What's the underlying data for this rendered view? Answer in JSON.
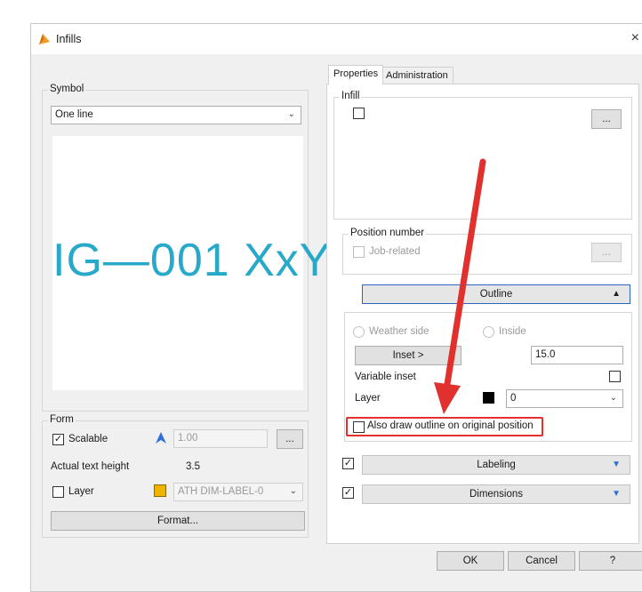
{
  "window": {
    "title": "Infills",
    "close_glyph": "×"
  },
  "symbol": {
    "group_label": "Symbol",
    "dropdown_value": "One line",
    "preview_text": "IG—001 XxY"
  },
  "form": {
    "group_label": "Form",
    "scalable_label": "Scalable",
    "scalable_checked": true,
    "scale_value": "1.00",
    "browse_label": "...",
    "text_height_label": "Actual text height",
    "text_height_value": "3.5",
    "layer_label": "Layer",
    "layer_value": "ATH DIM-LABEL-0",
    "layer_color": "#f0b400",
    "format_button": "Format..."
  },
  "tabs": [
    {
      "label": "Properties",
      "active": true
    },
    {
      "label": "Administration",
      "active": false
    }
  ],
  "infill": {
    "group_label": "Infill",
    "browse_label": "..."
  },
  "position_number": {
    "group_label": "Position number",
    "job_related_label": "Job-related",
    "browse_label": "..."
  },
  "outline": {
    "header": "Outline",
    "weather_side_label": "Weather side",
    "inside_label": "Inside",
    "inset_button": "Inset >",
    "inset_value": "15.0",
    "variable_inset_label": "Variable inset",
    "layer_label": "Layer",
    "layer_value": "0",
    "layer_color": "#000000",
    "also_draw_label": "Also draw outline on original position"
  },
  "labeling": {
    "header": "Labeling",
    "checked": true
  },
  "dimensions": {
    "header": "Dimensions",
    "checked": true
  },
  "footer": {
    "ok": "OK",
    "cancel": "Cancel",
    "help": "?"
  },
  "colors": {
    "preview_text": "#29a9c9",
    "annotation_red": "#e0312f",
    "accent_blue": "#2f6fd6"
  }
}
